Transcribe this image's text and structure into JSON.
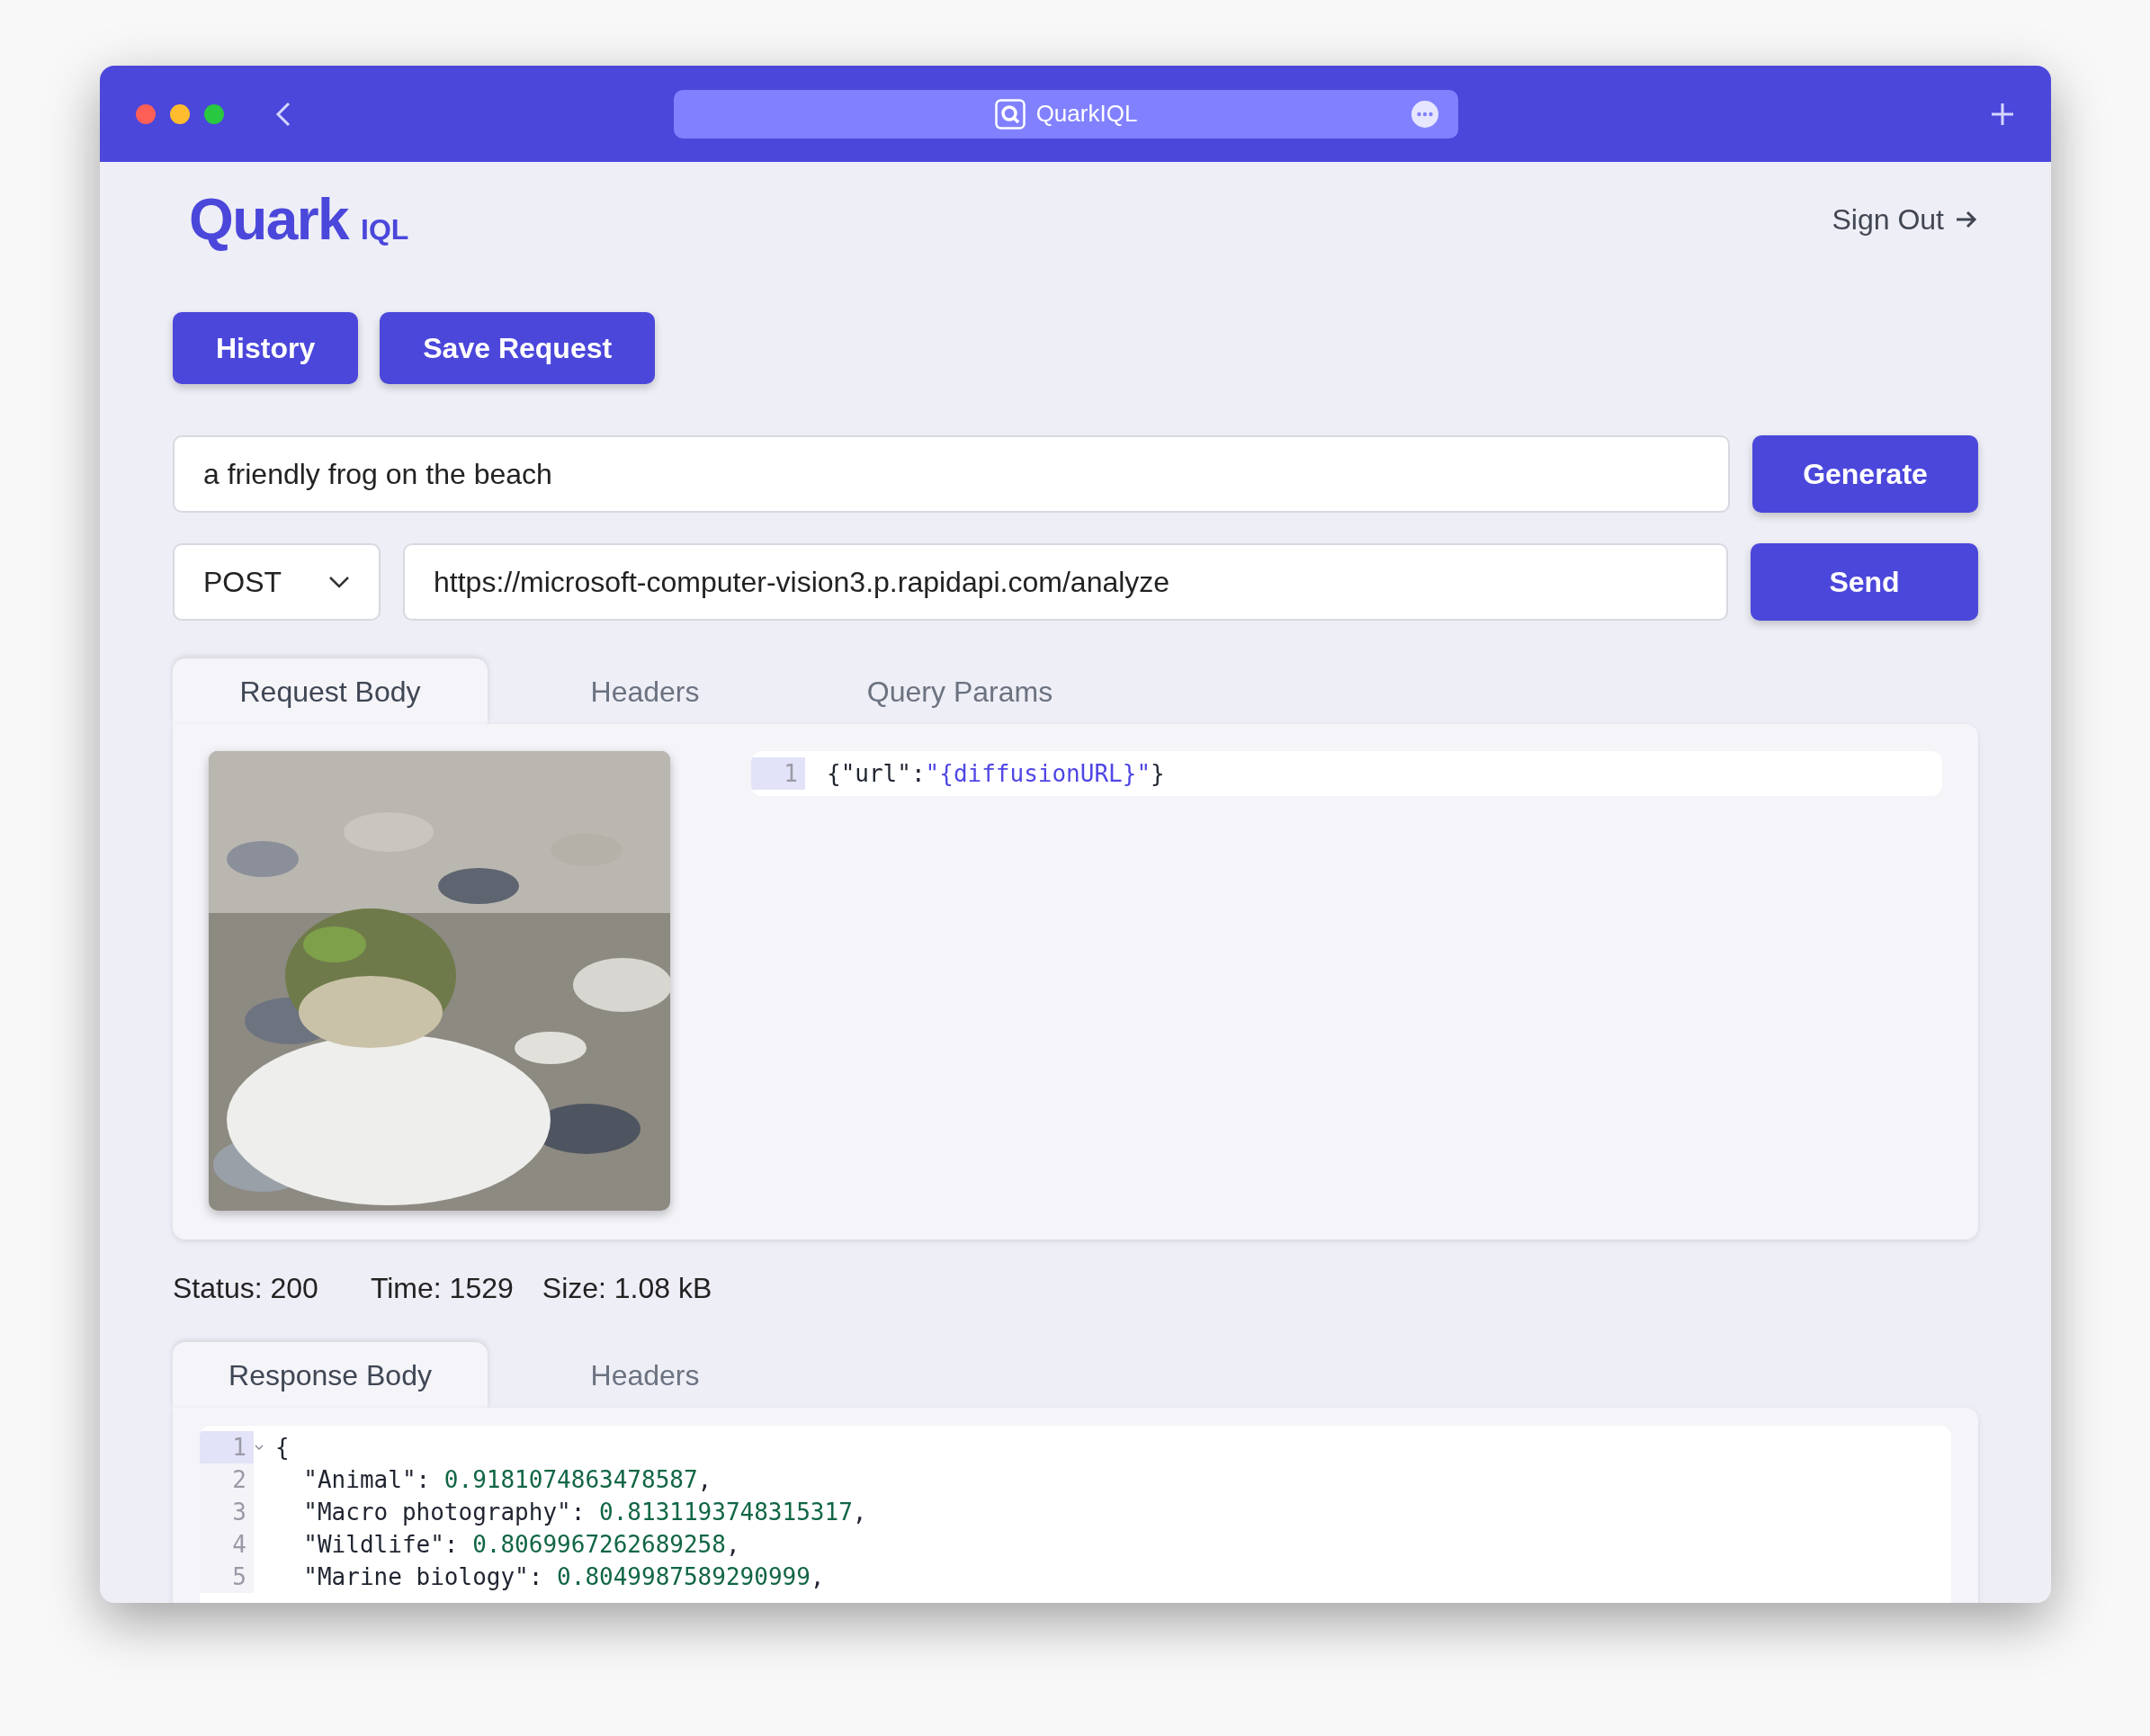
{
  "window": {
    "title": "QuarkIQL"
  },
  "header": {
    "logo": "Quark",
    "logo_suffix": "IQL",
    "sign_out": "Sign Out"
  },
  "actions": [
    "History",
    "Save Request"
  ],
  "prompt": {
    "value": "a friendly frog on the beach",
    "button": "Generate"
  },
  "request": {
    "method": "POST",
    "url": "https://microsoft-computer-vision3.p.rapidapi.com/analyze",
    "button": "Send"
  },
  "request_tabs": [
    {
      "label": "Request Body",
      "selected": true
    },
    {
      "label": "Headers",
      "selected": false
    },
    {
      "label": "Query Params",
      "selected": false
    }
  ],
  "request_body": {
    "lines": [
      {
        "number": "1",
        "active": true,
        "foldable": false,
        "tokens": [
          {
            "text": "{\"url\":",
            "kind": "plain"
          },
          {
            "text": "\"{diffusionURL}\"",
            "kind": "string"
          },
          {
            "text": "}",
            "kind": "plain"
          }
        ]
      }
    ]
  },
  "status": [
    "Status: 200",
    "Time: 1529",
    "Size: 1.08 kB"
  ],
  "response_tabs": [
    {
      "label": "Response Body",
      "selected": true
    },
    {
      "label": "Headers",
      "selected": false
    }
  ],
  "response_body": {
    "lines": [
      {
        "number": "1",
        "active": true,
        "foldable": true,
        "tokens": [
          {
            "text": "{",
            "kind": "plain"
          }
        ]
      },
      {
        "number": "2",
        "active": false,
        "foldable": false,
        "tokens": [
          {
            "text": "  \"Animal\": ",
            "kind": "plain"
          },
          {
            "text": "0.9181074863478587",
            "kind": "number"
          },
          {
            "text": ",",
            "kind": "plain"
          }
        ]
      },
      {
        "number": "3",
        "active": false,
        "foldable": false,
        "tokens": [
          {
            "text": "  \"Macro photography\": ",
            "kind": "plain"
          },
          {
            "text": "0.8131193748315317",
            "kind": "number"
          },
          {
            "text": ",",
            "kind": "plain"
          }
        ]
      },
      {
        "number": "4",
        "active": false,
        "foldable": false,
        "tokens": [
          {
            "text": "  \"Wildlife\": ",
            "kind": "plain"
          },
          {
            "text": "0.8069967262689258",
            "kind": "number"
          },
          {
            "text": ",",
            "kind": "plain"
          }
        ]
      },
      {
        "number": "5",
        "active": false,
        "foldable": false,
        "tokens": [
          {
            "text": "  \"Marine biology\": ",
            "kind": "plain"
          },
          {
            "text": "0.8049987589290999",
            "kind": "number"
          },
          {
            "text": ",",
            "kind": "plain"
          }
        ]
      }
    ]
  }
}
